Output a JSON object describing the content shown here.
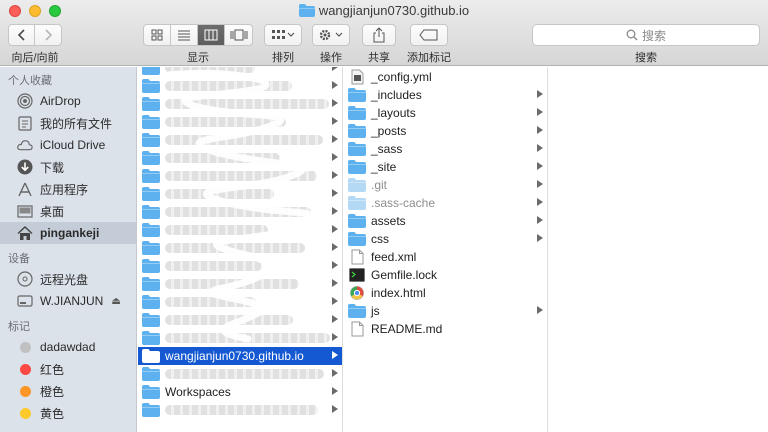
{
  "window": {
    "title": "wangjianjun0730.github.io"
  },
  "toolbar": {
    "back_forward_label": "向后/向前",
    "view_label": "显示",
    "arrange_label": "排列",
    "action_label": "操作",
    "share_label": "共享",
    "tags_label": "添加标记",
    "search_placeholder": "搜索",
    "search_label": "搜索"
  },
  "sidebar": {
    "favorites_header": "个人收藏",
    "favorites": [
      {
        "label": "AirDrop",
        "icon": "airdrop-icon"
      },
      {
        "label": "我的所有文件",
        "icon": "all-files-icon"
      },
      {
        "label": "iCloud Drive",
        "icon": "cloud-icon"
      },
      {
        "label": "下载",
        "icon": "downloads-icon"
      },
      {
        "label": "应用程序",
        "icon": "applications-icon"
      },
      {
        "label": "桌面",
        "icon": "desktop-icon"
      },
      {
        "label": "pingankeji",
        "icon": "home-icon"
      }
    ],
    "devices_header": "设备",
    "devices": [
      {
        "label": "远程光盘",
        "icon": "disc-icon"
      },
      {
        "label": "W.JIANJUN",
        "icon": "drive-icon"
      }
    ],
    "tags_header": "标记",
    "tags": [
      {
        "label": "dadawdad",
        "color": "#c0c0c0"
      },
      {
        "label": "红色",
        "color": "#fc4944"
      },
      {
        "label": "橙色",
        "color": "#fd9527"
      },
      {
        "label": "黄色",
        "color": "#fdc92b"
      }
    ]
  },
  "column1": {
    "selected": {
      "label": "wangjianjun0730.github.io"
    },
    "workspaces": {
      "label": "Workspaces"
    }
  },
  "column2": {
    "items": [
      {
        "label": "_config.yml",
        "kind": "file",
        "icon": "yml-file-icon"
      },
      {
        "label": "_includes",
        "kind": "folder"
      },
      {
        "label": "_layouts",
        "kind": "folder"
      },
      {
        "label": "_posts",
        "kind": "folder"
      },
      {
        "label": "_sass",
        "kind": "folder"
      },
      {
        "label": "_site",
        "kind": "folder"
      },
      {
        "label": ".git",
        "kind": "hidden-folder"
      },
      {
        "label": ".sass-cache",
        "kind": "hidden-folder"
      },
      {
        "label": "assets",
        "kind": "folder"
      },
      {
        "label": "css",
        "kind": "folder"
      },
      {
        "label": "feed.xml",
        "kind": "file",
        "icon": "xml-file-icon"
      },
      {
        "label": "Gemfile.lock",
        "kind": "file",
        "icon": "terminal-file-icon"
      },
      {
        "label": "index.html",
        "kind": "file",
        "icon": "html-file-icon"
      },
      {
        "label": "js",
        "kind": "folder"
      },
      {
        "label": "README.md",
        "kind": "file",
        "icon": "md-file-icon"
      }
    ]
  },
  "colors": {
    "selection": "#1559d2",
    "folder": "#5db1ef",
    "sidebar": "#dce2ea"
  }
}
